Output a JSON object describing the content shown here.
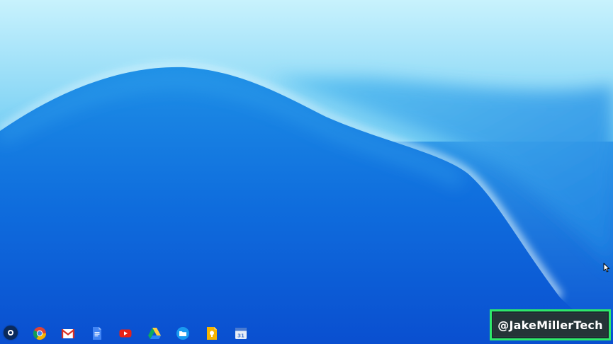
{
  "desktop": {
    "wallpaper": {
      "colors": {
        "light": "#bfeefc",
        "mid": "#3fb2ee",
        "deep": "#0a55d4"
      }
    }
  },
  "shelf": {
    "launcher": {
      "icon": "launcher-circle-icon"
    },
    "apps": [
      {
        "name": "chrome",
        "icon": "chrome-icon"
      },
      {
        "name": "gmail",
        "icon": "gmail-icon"
      },
      {
        "name": "docs",
        "icon": "docs-icon"
      },
      {
        "name": "youtube",
        "icon": "youtube-icon"
      },
      {
        "name": "drive",
        "icon": "drive-icon"
      },
      {
        "name": "files",
        "icon": "files-icon"
      },
      {
        "name": "keep",
        "icon": "keep-icon"
      },
      {
        "name": "calendar",
        "icon": "calendar-icon",
        "label": "31"
      }
    ]
  },
  "watermark": {
    "text": "@JakeMillerTech",
    "border_color": "#2ee86a"
  },
  "cursor": {
    "icon": "mouse-pointer-icon"
  }
}
